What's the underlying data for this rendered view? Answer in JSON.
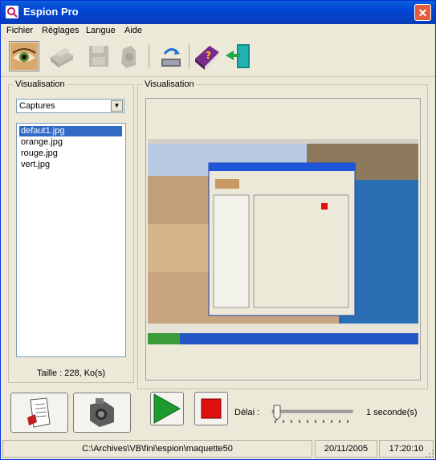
{
  "window": {
    "title": "Espion Pro",
    "close_label": "✕"
  },
  "menu": [
    "Fichier",
    "Réglages",
    "Langue",
    "Aide"
  ],
  "toolbar": [
    {
      "name": "eye",
      "icon": "eye-icon"
    },
    {
      "name": "printer",
      "icon": "printer-icon"
    },
    {
      "name": "save",
      "icon": "floppy-disk-icon"
    },
    {
      "name": "scanner",
      "icon": "scanner-icon"
    },
    {
      "name": "refresh",
      "icon": "refresh-icon"
    },
    {
      "name": "help",
      "icon": "help-book-icon"
    },
    {
      "name": "exit",
      "icon": "exit-door-icon"
    }
  ],
  "left_panel": {
    "group_label": "Visualisation",
    "dropdown_value": "Captures",
    "files": [
      "defaut1.jpg",
      "orange.jpg",
      "rouge.jpg",
      "vert.jpg"
    ],
    "selected_index": 0,
    "size_label": "Taille : 228, Ko(s)"
  },
  "right_panel": {
    "group_label": "Visualisation"
  },
  "controls": {
    "delay_label": "Délai :",
    "delay_value": "1 seconde(s)",
    "slider_position": 0.0
  },
  "status": {
    "path": "C:\\Archives\\VB\\fini\\espion\\maquette50",
    "date": "20/11/2005",
    "time": "17:20:10"
  },
  "colors": {
    "accent": "#316ac5",
    "play": "#1e9a2e",
    "stop": "#e01010"
  }
}
